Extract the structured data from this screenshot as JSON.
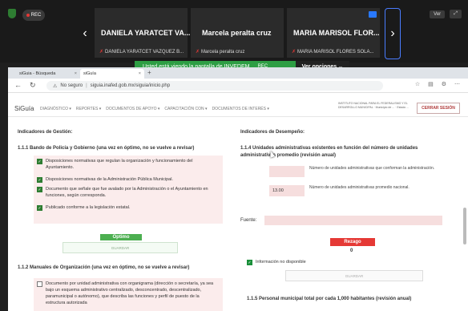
{
  "meeting": {
    "rec_label": "REC",
    "tiles": [
      {
        "name": "DANIELA YARATCET VA...",
        "footer": "DANIELA YARATCET VAZQUEZ B..."
      },
      {
        "name": "Marcela peralta cruz",
        "footer": "Marcela peralta cruz"
      },
      {
        "name": "MARIA MARISOL FLOR...",
        "footer": "MARIA MARISOL FLORES SOLA..."
      }
    ],
    "view_label": "Ver",
    "share_message": "Usted está viendo la pantalla de  INVEDEM",
    "share_rec": "REC",
    "options_label": "Ver opciones ⌄"
  },
  "browser": {
    "tabs": [
      {
        "label": "siGuia - Búsqueda"
      },
      {
        "label": "siGuía"
      }
    ],
    "security_label": "No seguro",
    "url": "siguia.inafed.gob.mx/siguia/inicio.php"
  },
  "site": {
    "brand": "SiGuía",
    "menu": [
      "DIAGNÓSTICO ▾",
      "REPORTES ▾",
      "DOCUMENTOS DE APOYO ▾",
      "CAPACITACIÓN CON ▾",
      "DOCUMENTOS DE INTERÉS ▾"
    ],
    "org_info": "INSTITUTO NACIONAL PARA EL FEDERALISMO Y EL DESARROLLO MUNICIPAL · Municipio de ... · Estado ...",
    "logout_label": "CERRAR SESIÓN"
  },
  "left": {
    "section_title": "Indicadores de Gestión:",
    "q1_title": "1.1.1 Bando de Policía y Gobierno (una vez en óptimo, no se vuelve a revisar)",
    "q1_items": [
      {
        "text": "Disposiciones normativas que regulan la organización y funcionamiento del Ayuntamiento.",
        "checked": true
      },
      {
        "text": "Disposiciones normativas de la Administración Pública Municipal.",
        "checked": true
      },
      {
        "text": "Documento que señale que fue avalado por la Administración o el Ayuntamiento en funciones, según corresponda.",
        "checked": true
      },
      {
        "text": "Publicado conforme a la legislación estatal.",
        "checked": true
      }
    ],
    "q1_status": "Óptimo",
    "q1_save": "GUARDAR",
    "q2_title": "1.1.2 Manuales de Organización (una vez en óptimo, no se vuelve a revisar)",
    "q2_item": "Documento por unidad administrativa con organigrama (dirección o secretaría, ya sea bajo un esquema administrativo centralizado, desconcentrado, descentralizado, paramunicipal o autónomo), que describa las funciones y perfil de puesto de la estructura autorizada"
  },
  "right": {
    "section_title": "Indicadores de Desempeño:",
    "q_title": "1.1.4 Unidades administrativas existentes en función del número de unidades administrativas promedio (revisión anual)",
    "field1_value": "",
    "field1_label": "Número de unidades administrativas que conforman la administración.",
    "field2_value": "13.00",
    "field2_label": "Número de unidades administrativas promedio nacional.",
    "source_label": "Fuente:",
    "status": "Rezago",
    "result": "0",
    "no_info_label": "Información no disponible",
    "save_label": "GUARDAR",
    "next_title": "1.1.5 Personal municipal total por cada 1,000 habitantes (revisión anual)"
  },
  "colors": {
    "share_green": "#2e9e44",
    "optimo_green": "#4caf50",
    "rezago_red": "#e53935",
    "checkbox_green": "#2e7d32",
    "field_pink": "#f6dede"
  }
}
